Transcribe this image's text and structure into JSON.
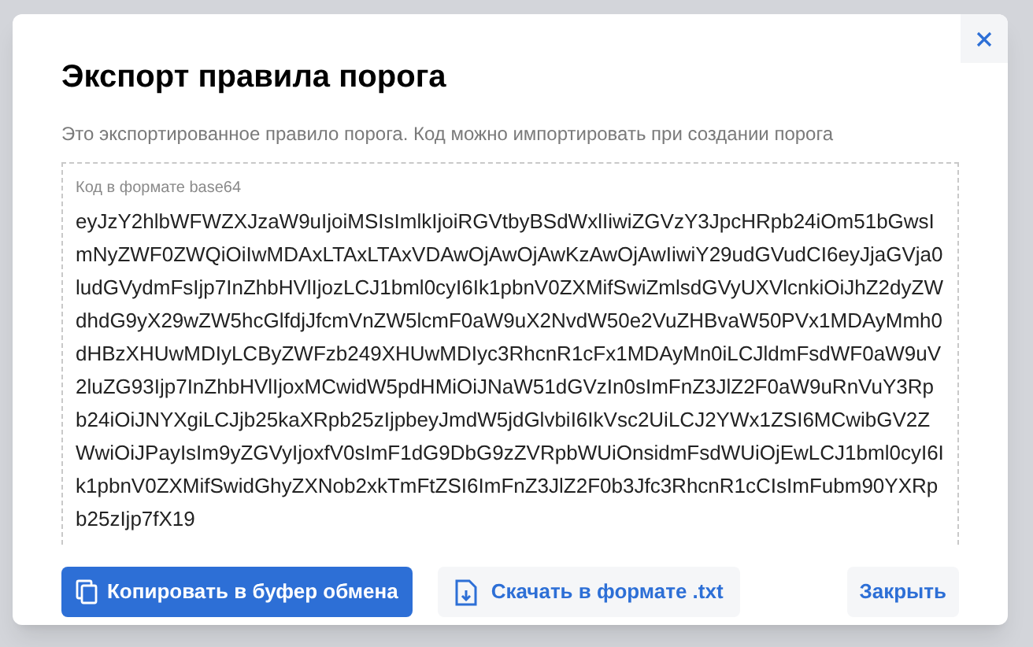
{
  "dialog": {
    "title": "Экспорт правила порога",
    "description": "Это экспортированное правило порога. Код можно импортировать при создании порога",
    "code_field": {
      "label": "Код в формате base64",
      "value": "eyJzY2hlbWFWZXJzaW9uIjoiMSIsImlkIjoiRGVtbyBSdWxlIiwiZGVzY3JpcHRpb24iOm51bGwsImNyZWF0ZWQiOiIwMDAxLTAxLTAxVDAwOjAwOjAwKzAwOjAwIiwiY29udGVudCI6eyJjaGVja0ludGVydmFsIjp7InZhbHVlIjozLCJ1bml0cyI6Ik1pbnV0ZXMifSwiZmlsdGVyUXVlcnkiOiJhZ2dyZWdhdG9yX29wZW5hcGlfdjJfcmVnZW5lcmF0aW9uX2NvdW50e2VuZHBvaW50PVx1MDAyMmh0dHBzXHUwMDIyLCByZWFzb249XHUwMDIyc3RhcnR1cFx1MDAyMn0iLCJldmFsdWF0aW9uV2luZG93Ijp7InZhbHVlIjoxMCwidW5pdHMiOiJNaW51dGVzIn0sImFnZ3JlZ2F0aW9uRnVuY3Rpb24iOiJNYXgiLCJjb25kaXRpb25zIjpbeyJmdW5jdGlvbiI6IkVsc2UiLCJ2YWx1ZSI6MCwibGV2ZWwiOiJPayIsIm9yZGVyIjoxfV0sImF1dG9DbG9zZVRpbWUiOnsidmFsdWUiOjEwLCJ1bml0cyI6Ik1pbnV0ZXMifSwidGhyZXNob2xkTmFtZSI6ImFnZ3JlZ2F0b3Jfc3RhcnR1cCIsImFubm90YXRpb25zIjp7fX19"
    },
    "buttons": [
      {
        "label": "Копировать в буфер обмена",
        "kind": "primary"
      },
      {
        "label": "Скачать в формате .txt",
        "kind": "secondary"
      },
      {
        "label": "Закрыть",
        "kind": "plain"
      }
    ]
  }
}
